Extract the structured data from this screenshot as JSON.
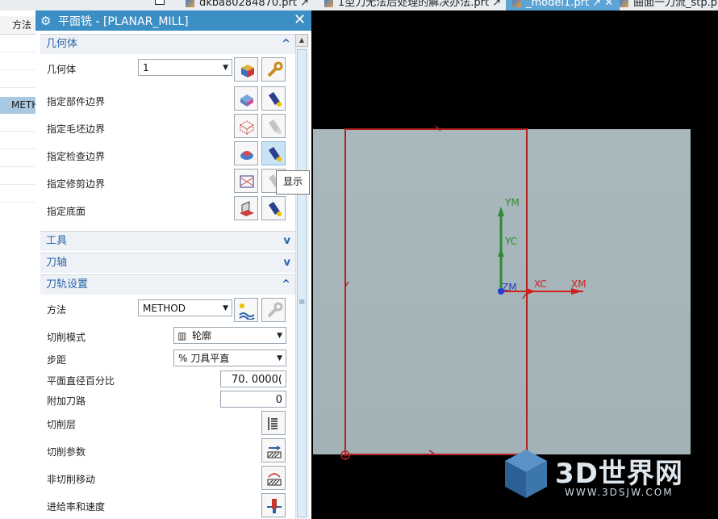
{
  "tabs": [
    {
      "label": "dkba80284870.prt",
      "active": false
    },
    {
      "label": "1型刀无法后处理的解决办法.prt",
      "active": false
    },
    {
      "label": "_model1.prt",
      "active": true
    },
    {
      "label": "曲面一刀流_stp.prt",
      "active": false
    }
  ],
  "navigator": {
    "header": "方法",
    "selected": "METH"
  },
  "dialog": {
    "title": "平面铣 - [PLANAR_MILL]",
    "close_label": "✕",
    "geometry": {
      "header": "几何体",
      "geometry_label": "几何体",
      "geometry_value": "1",
      "rows": [
        "指定部件边界",
        "指定毛坯边界",
        "指定检查边界",
        "指定修剪边界",
        "指定底面"
      ]
    },
    "tool_header": "工具",
    "axis_header": "刀轴",
    "path_settings": {
      "header": "刀轨设置",
      "method_label": "方法",
      "method_value": "METHOD",
      "cut_mode_label": "切削模式",
      "cut_mode_value": "轮廓",
      "stepover_label": "步距",
      "stepover_value": "% 刀具平直",
      "percent_label": "平面直径百分比",
      "percent_value": "70. 0000(",
      "additional_label": "附加刀路",
      "additional_value": "0",
      "rows": [
        "切削层",
        "切削参数",
        "非切削移动",
        "进给率和速度"
      ]
    },
    "tooltip": "显示"
  },
  "viewport": {
    "labels": {
      "ym": "YM",
      "yc": "YC",
      "zm": "ZM",
      "xc": "XC",
      "xm": "XM"
    }
  },
  "watermark": {
    "brand": "3D世界网",
    "url": "WWW.3DSJW.COM"
  },
  "colors": {
    "title_bar": "#3b8fc4",
    "section_text": "#2b63a7",
    "boundary": "#b3201f",
    "axis_x": "#d02020",
    "axis_y": "#2e8b2e",
    "axis_z": "#2040d0"
  }
}
